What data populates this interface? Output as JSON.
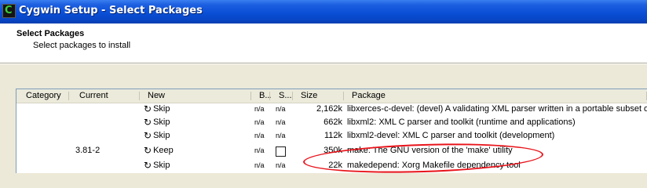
{
  "window": {
    "title": "Cygwin Setup - Select Packages"
  },
  "header": {
    "title": "Select Packages",
    "subtitle": "Select packages to install"
  },
  "columns": [
    "Category",
    "Current",
    "New",
    "B...",
    "S...",
    "Size",
    "Package"
  ],
  "rows": [
    {
      "current": "",
      "new": "Skip",
      "bin": "n/a",
      "src": "n/a",
      "size": "2,162k",
      "package": "libxerces-c-devel: (devel) A validating XML parser written in a portable subset of C++"
    },
    {
      "current": "",
      "new": "Skip",
      "bin": "n/a",
      "src": "n/a",
      "size": "662k",
      "package": "libxml2: XML C parser and toolkit (runtime and applications)"
    },
    {
      "current": "",
      "new": "Skip",
      "bin": "n/a",
      "src": "n/a",
      "size": "112k",
      "package": "libxml2-devel: XML C parser and toolkit (development)"
    },
    {
      "current": "3.81-2",
      "new": "Keep",
      "bin": "n/a",
      "src": "",
      "size": "350k",
      "package": "make: The GNU version of the 'make' utility"
    },
    {
      "current": "",
      "new": "Skip",
      "bin": "n/a",
      "src": "n/a",
      "size": "22k",
      "package": "makedepend: Xorg Makefile dependency tool"
    }
  ],
  "icons": {
    "app": "cygwin-icon",
    "cycle": "cycle-icon",
    "checkbox": "checkbox-icon"
  },
  "colors": {
    "titlebar": "#0a4fd6",
    "highlight": "#e8131a"
  }
}
